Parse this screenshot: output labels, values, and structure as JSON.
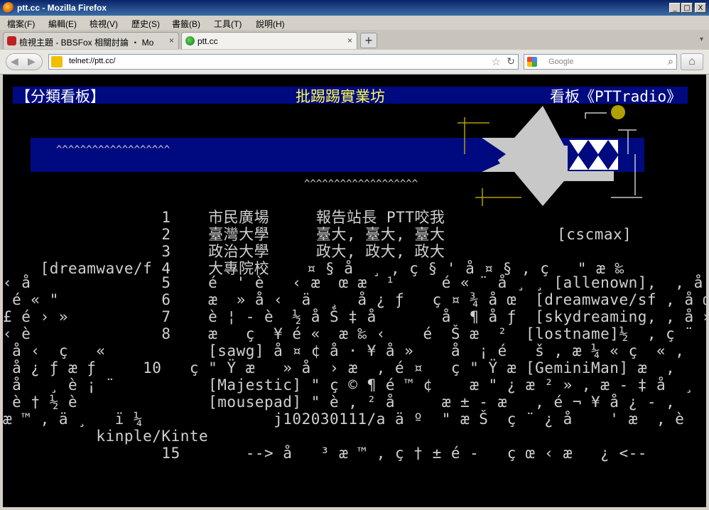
{
  "window": {
    "title": "ptt.cc - Mozilla Firefox",
    "buttons": {
      "minimize": "_",
      "maximize": "□",
      "close": "X"
    }
  },
  "menu": [
    "檔案(F)",
    "編輯(E)",
    "檢視(V)",
    "歷史(S)",
    "書籤(B)",
    "工具(T)",
    "說明(H)"
  ],
  "tabs": [
    {
      "label": "檢視主題 - BBSFox 相關討論 ・ Mozil...",
      "close": "×"
    },
    {
      "label": "ptt.cc",
      "close": "×"
    }
  ],
  "newtab": "+",
  "tablist_icon": "▾",
  "nav": {
    "back_icon": "back-arrow-icon",
    "forward_icon": "forward-arrow-icon",
    "url": "telnet://ptt.cc/",
    "star": "☆",
    "reload": "↻",
    "search_placeholder": "Google",
    "search_icon": "⌕",
    "home_icon": "⌂"
  },
  "terminal": {
    "header": {
      "left": "【分類看板】",
      "center": "批踢踢實業坊",
      "right": "看板《PTTradio》"
    },
    "colors": {
      "header_bg": "#000a80",
      "header_left": "#ffffff",
      "header_center": "#ffff55",
      "header_right": "#ffffff",
      "banner": "#000a80",
      "fish": "#c8c8c8",
      "yellow": "#b0a000"
    },
    "wave1": "^^^^^^^^^^^^^^^^^^^",
    "wave2": "^^^^^^^^^^^^^^^^^^^",
    "lines": [
      "                 1    市民廣場     報告站長 PTT咬我",
      "                 2    臺灣大學     臺大, 臺大, 臺大            [cscmax]",
      "                 3    政治大學     政大, 政大, 政大",
      "    [dreamwave/f 4    大專院校    ¤ § å  ¸ , ç § ' å ¤ § , ç   \" æ ‰",
      "‹ å              5    é  ' è   ‹ æ  œ æ  ¹     é « ¨ å ¸ ¸ [allenown],  , å œ",
      " é « \"           6    æ  » å ‹  ä  ¸  å ¿ ƒ   ç ¤ ¾ å œ  [dreamwave/sf , å œ",
      "£ é › »          7    è ¦ - è  ½ å Š ‡ å       å  ¶ å ƒ  [skydreaming, , å »",
      "‹ è              8    æ   ç  ¥ é «  æ ‰ ‹    é  Š æ  ²  [lostname]½  , ç ¨",
      " å ‹  ç   «           [sawg] å ¤ ¢ å · ¥ å »    å  ¡ é   š , æ ¼ « ç  « ,",
      " å ¿ ƒ æ ƒ     10   ç \" Ÿ æ   » å  › æ  , é ¤   ç \" Ÿ æ [GeminiMan] æ  ,",
      " å   ¸ è ¡ ¨          [Majestic] \" ç © ¶ é ™ ¢    æ \" ¿ æ ² » , æ - ‡ å  ¸",
      " è † ½ è              [mousepad] \" è , ² å     æ ± - æ   , é ¬ ¥ å ¿ - ,",
      "æ ™ , ä ¸   ï ¼              j102030111/a ä º  \" æ Š  ç ¨ ¿ å    ' æ  , è",
      "          kinple/Kinte",
      "                 15       --> å   ³ æ ™ , ç † ± é -   ç œ ‹ æ   ¿ <--"
    ]
  }
}
